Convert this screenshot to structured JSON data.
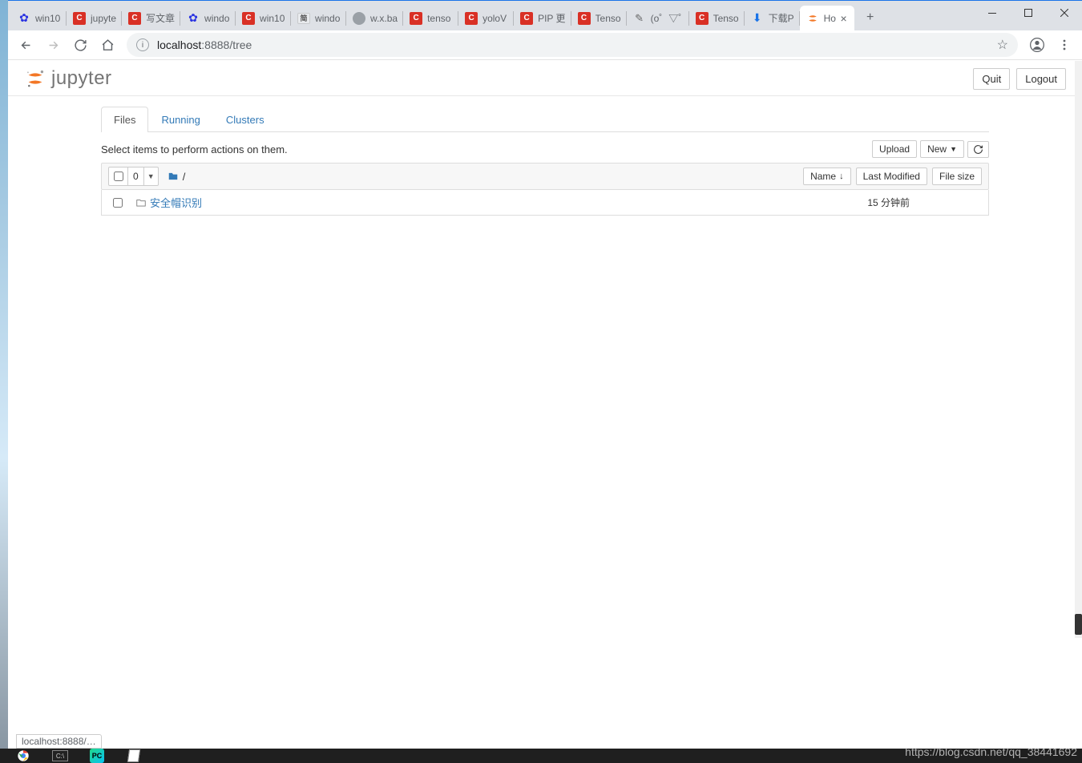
{
  "browser": {
    "tabs": [
      {
        "title": "win10",
        "favicon": "paw"
      },
      {
        "title": "jupyte",
        "favicon": "red-c"
      },
      {
        "title": "写文章",
        "favicon": "red-c"
      },
      {
        "title": "windo",
        "favicon": "paw"
      },
      {
        "title": "win10",
        "favicon": "red-c"
      },
      {
        "title": "windo",
        "favicon": "ctrl"
      },
      {
        "title": "w.x.ba",
        "favicon": "globe"
      },
      {
        "title": "tenso",
        "favicon": "red-c"
      },
      {
        "title": "yoloV",
        "favicon": "red-c"
      },
      {
        "title": "PIP 更",
        "favicon": "red-c"
      },
      {
        "title": "Tenso",
        "favicon": "red-c"
      },
      {
        "title": "(o゜▽゜)",
        "favicon": "scribe"
      },
      {
        "title": "Tenso",
        "favicon": "red-c"
      },
      {
        "title": "下载P",
        "favicon": "download"
      },
      {
        "title": "Ho",
        "favicon": "jupyter",
        "active": true
      }
    ],
    "url_host": "localhost",
    "url_port": ":8888",
    "url_path": "/tree",
    "status_tooltip": "localhost:8888/…"
  },
  "jupyter": {
    "logo_text": "jupyter",
    "quit_label": "Quit",
    "logout_label": "Logout",
    "tabs": {
      "files": "Files",
      "running": "Running",
      "clusters": "Clusters"
    },
    "hint": "Select items to perform actions on them.",
    "upload_label": "Upload",
    "new_label": "New",
    "selected_count": "0",
    "breadcrumb_sep": "/",
    "hdr_name": "Name",
    "hdr_modified": "Last Modified",
    "hdr_size": "File size",
    "rows": [
      {
        "name": "安全帽识别",
        "modified": "15 分钟前",
        "size": ""
      }
    ]
  },
  "watermark": "https://blog.csdn.net/qq_38441692"
}
